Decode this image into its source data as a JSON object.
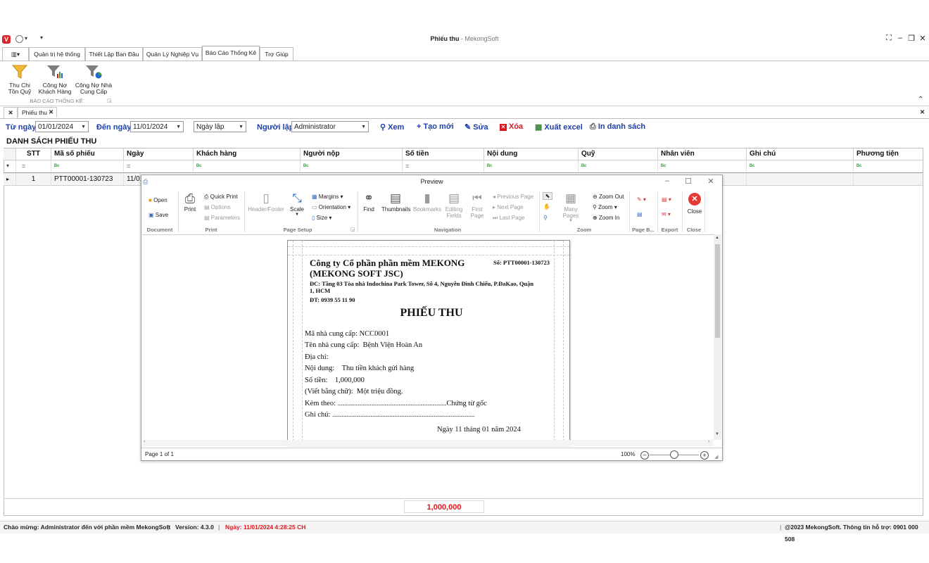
{
  "window": {
    "title": "Phiếu thu",
    "app_name": "MekongSoft",
    "separator": " - ",
    "logo_letter": "V"
  },
  "menu_tabs": [
    {
      "label": "Quản trị hệ thống"
    },
    {
      "label": "Thiết Lập Ban Đầu"
    },
    {
      "label": "Quản Lý Nghiệp Vụ"
    },
    {
      "label": "Báo Cáo Thống Kê"
    },
    {
      "label": "Trợ Giúp"
    }
  ],
  "ribbon": {
    "buttons": [
      {
        "line1": "Thu Chi",
        "line2": "Tồn Quỹ"
      },
      {
        "line1": "Công Nợ",
        "line2": "Khách Hàng"
      },
      {
        "line1": "Công Nợ Nhà",
        "line2": "Cung Cấp"
      }
    ],
    "group_label": "BÁO CÁO THỐNG KÊ"
  },
  "doc_tab": {
    "label": "Phiếu thu"
  },
  "filters": {
    "from_label": "Từ ngày",
    "from_value": "01/01/2024",
    "to_label": "Đến ngày",
    "to_value": "11/01/2024",
    "date_type": "Ngày lập",
    "creator_label": "Người lập",
    "creator_value": "Administrator"
  },
  "actions": {
    "view": "Xem",
    "create": "Tạo mới",
    "edit": "Sửa",
    "delete": "Xóa",
    "export": "Xuất excel",
    "print_list": "In danh sách"
  },
  "grid": {
    "title": "DANH SÁCH PHIẾU THU",
    "columns": [
      "STT",
      "Mã số phiếu",
      "Ngày",
      "Khách hàng",
      "Người nộp",
      "Số tiền",
      "Nội dung",
      "Quỹ",
      "Nhân viên",
      "Ghi chú",
      "Phương tiện"
    ],
    "filter_eq": "=",
    "filter_contains": "ᴮᶜ",
    "row": {
      "stt": "1",
      "code": "PTT00001-130723",
      "date": "11/01"
    },
    "total": "1,000,000"
  },
  "preview": {
    "title": "Preview",
    "document": {
      "open": "Open",
      "save": "Save",
      "label": "Document"
    },
    "print": {
      "print": "Print",
      "quick_print": "Quick Print",
      "options": "Options",
      "parameters": "Parameters",
      "label": "Print"
    },
    "page_setup": {
      "header_footer": "Header/Footer",
      "scale": "Scale",
      "margins": "Margins",
      "orientation": "Orientation",
      "size": "Size",
      "label": "Page Setup"
    },
    "navigation": {
      "find": "Find",
      "thumbnails": "Thumbnails",
      "bookmarks": "Bookmarks",
      "editing_fields_1": "Editing",
      "editing_fields_2": "Fields",
      "first_page_1": "First",
      "first_page_2": "Page",
      "previous_page": "Previous Page",
      "next_page": "Next Page",
      "last_page": "Last Page",
      "label": "Navigation"
    },
    "zoom": {
      "many_pages": "Many Pages",
      "zoom_out": "Zoom Out",
      "zoom": "Zoom",
      "zoom_in": "Zoom In",
      "label": "Zoom"
    },
    "page_bg_label": "Page B...",
    "export_label": "Export",
    "close": {
      "close": "Close",
      "label": "Close"
    },
    "page_status": "Page 1 of 1",
    "zoom_value": "100%"
  },
  "report": {
    "company_1": "Công ty Cổ phần phần mềm MEKONG",
    "company_2": "(MEKONG SOFT JSC)",
    "number": "Số: PTT00001-130723",
    "address_1": "ĐC: Tầng 03 Tòa nhà Indochina Park Tower, Số 4, Nguyễn Đình Chiểu, P.ĐaKao, Quận",
    "address_2": "1, HCM",
    "phone": "ĐT: 0939 55 11 90",
    "doc_title": "PHIẾU THU",
    "supplier_code_label": "Mã nhà cung cấp:",
    "supplier_code": "NCC0001",
    "supplier_name_label": "Tên nhà cung cấp:",
    "supplier_name": "Bệnh Viện Hoàn An",
    "address_label": "Địa chỉ:",
    "content_label": "Nội dung:",
    "content": "Thu tiền khách gửi hàng",
    "amount_label": "Số tiền:",
    "amount": "1,000,000",
    "words_label": "(Viết bằng chữ):",
    "words": "Một triệu đồng.",
    "attached_label": "Kèm theo:",
    "attached_dots": "...........................................................................................",
    "attached_tail": "Chứng từ gốc",
    "note_label": "Ghi chú:",
    "note_dots": ".......................................................................................................................",
    "date_line": "Ngày 11 tháng 01 năm 2024"
  },
  "status": {
    "welcome": "Chào mừng: Administrator đến với phần mềm MekongSoft",
    "version": "Version: 4.3.0",
    "date": "Ngày: 11/01/2024 4:28:25 CH",
    "copyright": "@2023 MekongSoft. Thông tin hỗ trợ: 0901 000 508"
  },
  "colors": {
    "accent": "#1e3fa8",
    "danger": "#e0141b",
    "close_red": "#e53935"
  }
}
